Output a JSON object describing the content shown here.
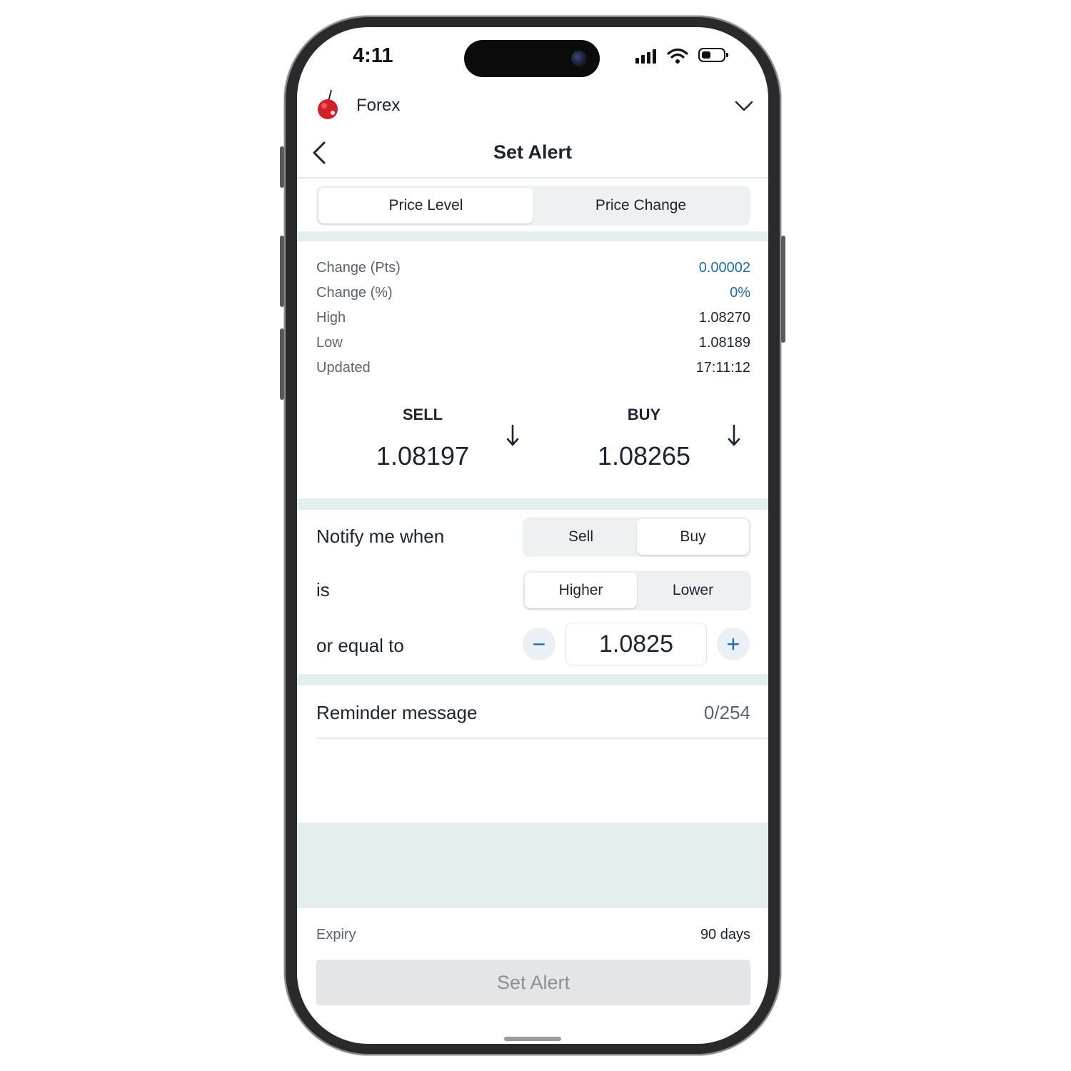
{
  "status_bar": {
    "time": "4:11"
  },
  "header": {
    "brand": "Forex",
    "title": "Set Alert"
  },
  "tabs": [
    {
      "label": "Price Level",
      "active": true
    },
    {
      "label": "Price Change",
      "active": false
    }
  ],
  "stats": [
    {
      "label": "Change (Pts)",
      "value": "0.00002"
    },
    {
      "label": "Change (%)",
      "value": "0%"
    },
    {
      "label": "High",
      "value": "1.08270"
    },
    {
      "label": "Low",
      "value": "1.08189"
    },
    {
      "label": "Updated",
      "value": "17:11:12"
    }
  ],
  "prices": {
    "sell": {
      "label": "SELL",
      "value": "1.08197"
    },
    "buy": {
      "label": "BUY",
      "value": "1.08265"
    }
  },
  "notify": {
    "label": "Notify me when",
    "options": [
      {
        "label": "Sell",
        "active": false
      },
      {
        "label": "Buy",
        "active": true
      }
    ]
  },
  "condition": {
    "label": "is",
    "options": [
      {
        "label": "Higher",
        "active": true
      },
      {
        "label": "Lower",
        "active": false
      }
    ]
  },
  "threshold": {
    "label": "or equal to",
    "value": "1.0825",
    "minus": "−",
    "plus": "+"
  },
  "reminder": {
    "label": "Reminder message",
    "counter": "0/254"
  },
  "expiry": {
    "label": "Expiry",
    "value": "90 days"
  },
  "submit": {
    "label": "Set Alert"
  },
  "colors": {
    "accent_blue": "#1f6aa5",
    "band": "#e5eeee",
    "disabled_bg": "#e4e5e7"
  }
}
